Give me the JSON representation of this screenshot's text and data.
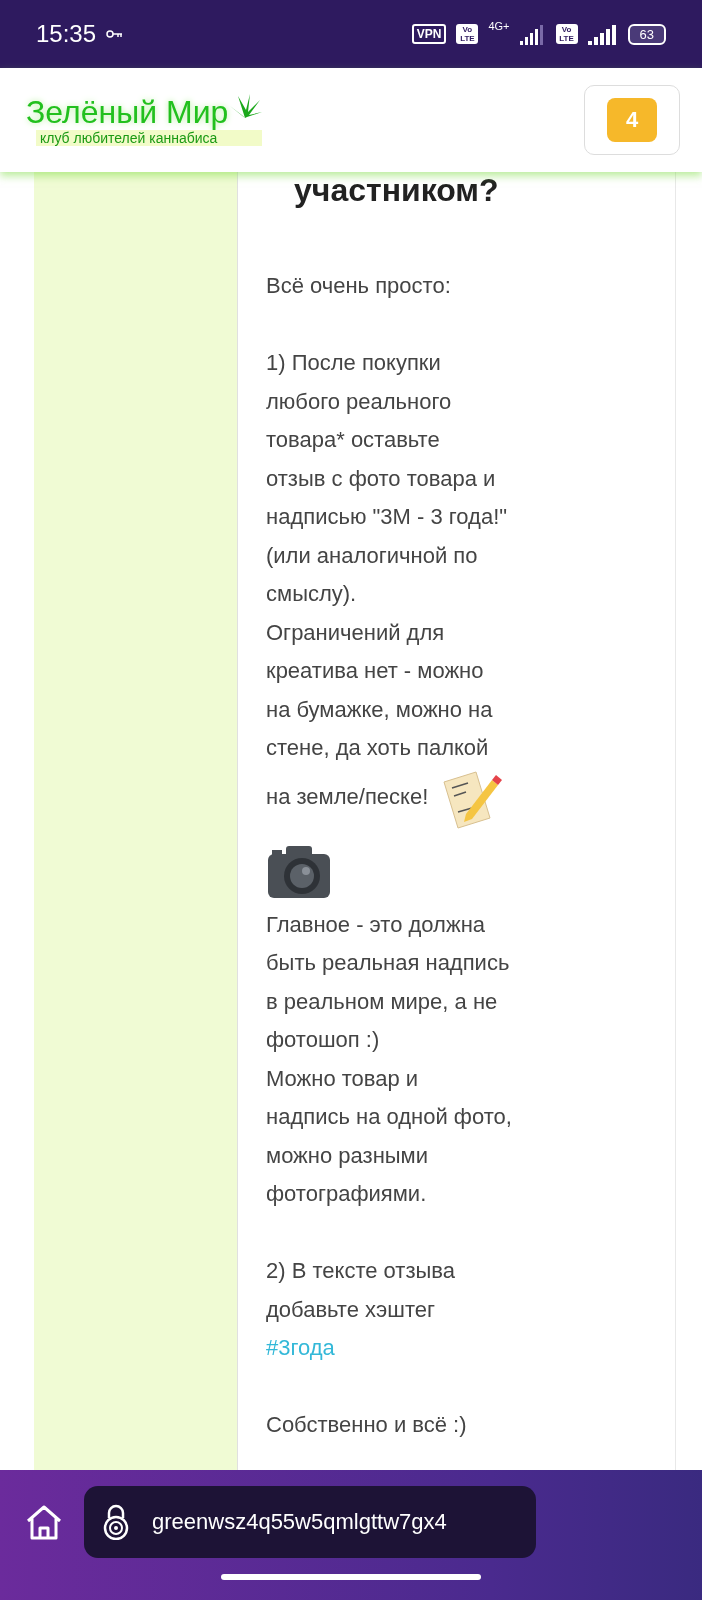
{
  "status_bar": {
    "time": "15:35",
    "vpn": "VPN",
    "volte": [
      "Vo LTE",
      "Vo LTE"
    ],
    "network": "4G+",
    "battery": "63"
  },
  "header": {
    "logo_title": "Зелёный Мир",
    "logo_subtitle": "клуб любителей каннабиса",
    "badge": "4"
  },
  "article": {
    "heading": "участником?",
    "blocks": [
      {
        "kind": "paragraph",
        "text": "Всё очень просто:"
      },
      {
        "kind": "paragraph-with-note",
        "text": "1) После покупки\nлюбого реального\nтовара* оставьте\nотзыв с фото товара и\nнадписью \"3М - 3 года!\"\n(или аналогичной по\nсмыслу).\nОграничений для\nкреатива нет - можно\nна бумажке, можно на\nстене, да хоть палкой\nна земле/песке!"
      },
      {
        "kind": "camera"
      },
      {
        "kind": "line",
        "text": "Главное - это должна\nбыть реальная надпись\nв реальном мире, а не\nфотошоп :)\nМожно товар и\nнадпись на одной фото,\nможно разными\nфотографиями."
      },
      {
        "kind": "paragraph",
        "text": "2) В тексте отзыва\nдобавьте хэштег"
      },
      {
        "kind": "link",
        "text": "#3года"
      },
      {
        "kind": "paragraph",
        "text": "Собственно и всё :)"
      }
    ]
  },
  "address_bar": {
    "url": "greenwsz4q55w5qmlgttw7gx4"
  }
}
